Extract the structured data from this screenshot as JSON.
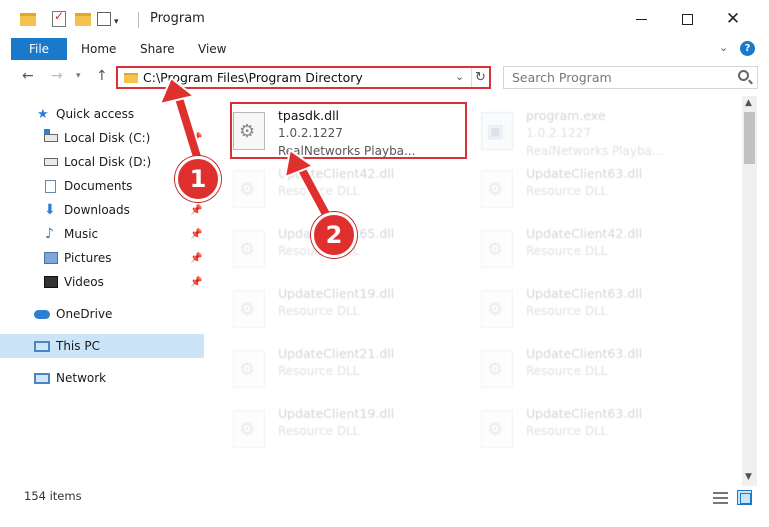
{
  "window": {
    "title": "Program",
    "minimize_icon": "minimize-icon",
    "maximize_icon": "maximize-icon",
    "close_icon": "close-icon",
    "close_glyph": "✕"
  },
  "ribbon": {
    "tabs": [
      {
        "label": "File"
      },
      {
        "label": "Home"
      },
      {
        "label": "Share"
      },
      {
        "label": "View"
      }
    ],
    "help_label": "?",
    "expand_glyph": "⌄"
  },
  "navigation": {
    "back_glyph": "←",
    "forward_glyph": "→",
    "recent_glyph": "▾",
    "up_glyph": "↑",
    "address": "C:\\Program Files\\Program Directory",
    "address_dropdown_glyph": "⌄",
    "refresh_glyph": "↻",
    "search_placeholder": "Search Program"
  },
  "sidebar": {
    "items": [
      {
        "label": "Quick access",
        "icon": "star-icon"
      },
      {
        "label": "Local Disk (C:)",
        "icon": "drive-icon"
      },
      {
        "label": "Local Disk (D:)",
        "icon": "drive-icon"
      },
      {
        "label": "Documents",
        "icon": "documents-icon"
      },
      {
        "label": "Downloads",
        "icon": "download-icon",
        "glyph": "⬇"
      },
      {
        "label": "Music",
        "icon": "music-icon",
        "glyph": "♪"
      },
      {
        "label": "Pictures",
        "icon": "pictures-icon"
      },
      {
        "label": "Videos",
        "icon": "videos-icon"
      },
      {
        "label": "OneDrive",
        "icon": "cloud-icon"
      },
      {
        "label": "This PC",
        "icon": "computer-icon"
      },
      {
        "label": "Network",
        "icon": "network-icon"
      }
    ],
    "star_glyph": "★",
    "pin_glyph": "📌"
  },
  "files": [
    {
      "name": "tpasdk.dll",
      "version": "1.0.2.1227",
      "description": "RealNetworks Playba..."
    },
    {
      "name": "program.exe",
      "version": "1.0.2.1227",
      "description": "RealNetworks Playba..."
    },
    {
      "name": "UpdateClient42.dll",
      "description": "Resource DLL"
    },
    {
      "name": "UpdateClient63.dll",
      "description": "Resource DLL"
    },
    {
      "name": "UpdateClient65.dll",
      "description": "Resource DLL"
    },
    {
      "name": "UpdateClient42.dll",
      "description": "Resource DLL"
    },
    {
      "name": "UpdateClient19.dll",
      "description": "Resource DLL"
    },
    {
      "name": "UpdateClient63.dll",
      "description": "Resource DLL"
    },
    {
      "name": "UpdateClient21.dll",
      "description": "Resource DLL"
    },
    {
      "name": "UpdateClient63.dll",
      "description": "Resource DLL"
    },
    {
      "name": "UpdateClient19.dll",
      "description": "Resource DLL"
    },
    {
      "name": "UpdateClient63.dll",
      "description": "Resource DLL"
    }
  ],
  "status": {
    "item_count": "154 items"
  },
  "scrollbar": {
    "up_glyph": "▲",
    "down_glyph": "▼"
  },
  "callouts": [
    {
      "label": "1"
    },
    {
      "label": "2"
    }
  ],
  "colors": {
    "accent": "#1979ca",
    "highlight_red": "#d9323a",
    "selected_bg": "#cce4f7"
  }
}
